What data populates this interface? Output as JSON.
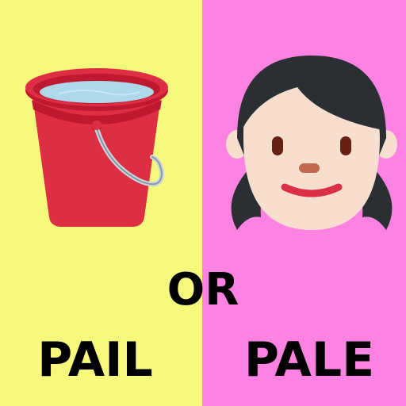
{
  "colors": {
    "left_background": "#f6f97c",
    "right_background": "#fe82e2",
    "text": "#000000",
    "bucket_red": "#dd2e44",
    "bucket_dark_red": "#be1931",
    "water": "#aed7e8",
    "skin": "#f7dece",
    "hair": "#292f33"
  },
  "left": {
    "picture": "bucket-icon",
    "word": "PAIL"
  },
  "center": {
    "word": "OR"
  },
  "right": {
    "picture": "girl-face-icon",
    "word": "PALE"
  }
}
